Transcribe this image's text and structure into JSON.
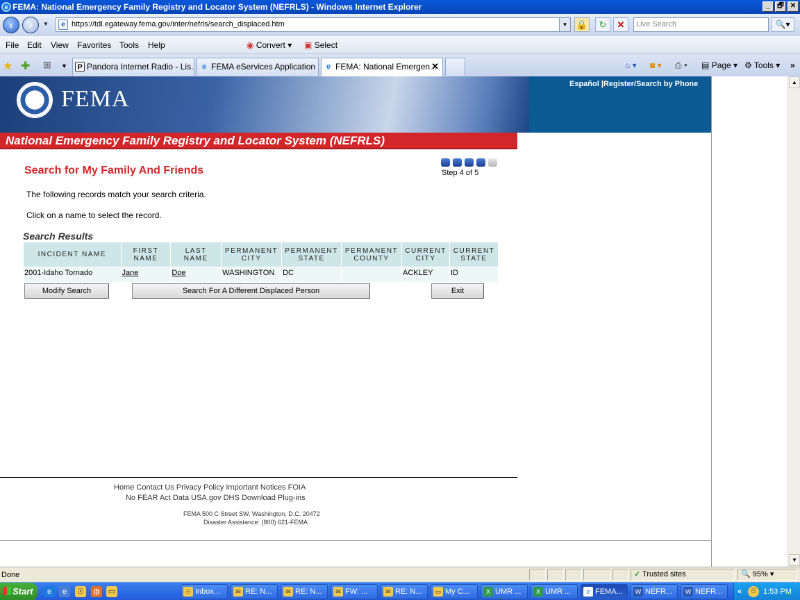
{
  "window": {
    "title": "FEMA: National Emergency Family Registry and Locator System (NEFRLS) - Windows Internet Explorer",
    "min": "_",
    "max": "🗗",
    "close": "✕"
  },
  "address": {
    "url": "https://tdl.egateway.fema.gov/inter/nefrls/search_displaced.htm",
    "search_placeholder": "Live Search"
  },
  "menu": [
    "File",
    "Edit",
    "View",
    "Favorites",
    "Tools",
    "Help"
  ],
  "menu_extra": {
    "convert": "Convert",
    "select": "Select"
  },
  "tabs": [
    {
      "label": "Pandora Internet Radio - Lis..."
    },
    {
      "label": "FEMA eServices Application ..."
    },
    {
      "label": "FEMA: National Emergen..."
    }
  ],
  "cmdbar": {
    "page": "Page",
    "tools": "Tools"
  },
  "banner": {
    "logo_text": "FEMA",
    "top_links": "Español |Register/Search by Phone",
    "system_name": "National Emergency Family Registry and Locator System (NEFRLS)"
  },
  "main": {
    "heading": "Search for My Family And Friends",
    "step_label": "Step 4 of 5",
    "steps_total": 5,
    "steps_done": 4,
    "intro1": "The following records match your search criteria.",
    "intro2": "Click on a name to select the record.",
    "results_heading": "Search Results",
    "columns": [
      "INCIDENT NAME",
      "FIRST NAME",
      "LAST NAME",
      "PERMANENT CITY",
      "PERMANENT STATE",
      "PERMANENT COUNTY",
      "CURRENT CITY",
      "CURRENT STATE"
    ],
    "rows": [
      {
        "incident": "2001-Idaho Tornado",
        "first": "Jane",
        "last": "Doe",
        "perm_city": "WASHINGTON",
        "perm_state": "DC",
        "perm_county": "",
        "cur_city": "ACKLEY",
        "cur_state": "ID"
      }
    ],
    "buttons": {
      "modify": "Modify Search",
      "different": "Search For A Different Displaced Person",
      "exit": "Exit"
    }
  },
  "footer": {
    "links1": "Home Contact Us Privacy Policy Important Notices FOIA",
    "links2": "No FEAR Act Data USA.gov DHS Download Plug-ins",
    "address1": "FEMA 500 C Street SW, Washington, D.C. 20472",
    "address2": "Disaster Assistance: (800) 621-FEMA"
  },
  "status": {
    "left": "Done",
    "zone": "Trusted sites",
    "zoom": "95%"
  },
  "taskbar": {
    "start": "Start",
    "items": [
      "Inbox...",
      "RE: N...",
      "RE: N...",
      "FW: ...",
      "RE: N...",
      "My C...",
      "UMR ...",
      "UMR ...",
      "FEMA...",
      "NEFR...",
      "NEFR..."
    ],
    "clock": "1:53 PM"
  }
}
